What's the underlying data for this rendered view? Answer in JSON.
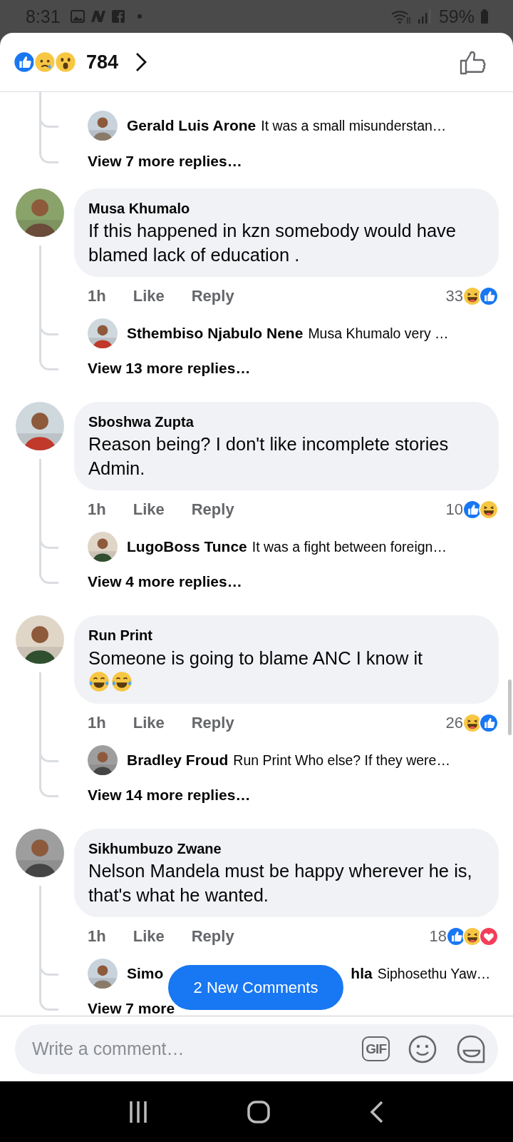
{
  "status_bar": {
    "time": "8:31",
    "battery": "59%"
  },
  "header": {
    "reactions": [
      {
        "kind": "like"
      },
      {
        "kind": "sad"
      },
      {
        "kind": "wow"
      }
    ],
    "reaction_count": "784"
  },
  "thread_top": {
    "reply": {
      "author": "Gerald Luis Arone",
      "text": "It was a small misunderstan…"
    },
    "more": "View 7 more replies…"
  },
  "comments": [
    {
      "author": "Musa Khumalo",
      "text": "If this happened in kzn somebody would have blamed lack of education .",
      "time": "1h",
      "like": "Like",
      "reply": "Reply",
      "reaction_count": "33",
      "reactions": [
        {
          "kind": "haha"
        },
        {
          "kind": "like"
        }
      ],
      "reply_preview": {
        "author": "Sthembiso Njabulo Nene",
        "text": "Musa Khumalo very …"
      },
      "more": "View 13 more replies…"
    },
    {
      "author": "Sboshwa Zupta",
      "text": "Reason being? I don't like incomplete stories Admin.",
      "time": "1h",
      "like": "Like",
      "reply": "Reply",
      "reaction_count": "10",
      "reactions": [
        {
          "kind": "like"
        },
        {
          "kind": "haha"
        }
      ],
      "reply_preview": {
        "author": "LugoBoss Tunce",
        "text": "It was a fight between foreign…"
      },
      "more": "View 4 more replies…"
    },
    {
      "author": "Run Print",
      "text": "Someone is going to blame ANC I know it",
      "emojis": [
        {
          "kind": "laugh-cry"
        },
        {
          "kind": "laugh-cry"
        }
      ],
      "time": "1h",
      "like": "Like",
      "reply": "Reply",
      "reaction_count": "26",
      "reactions": [
        {
          "kind": "haha"
        },
        {
          "kind": "like"
        }
      ],
      "reply_preview": {
        "author": "Bradley Froud",
        "text": "Run Print Who else? If they were…"
      },
      "more": "View 14 more replies…"
    },
    {
      "author": "Sikhumbuzo Zwane",
      "text": "Nelson Mandela must be happy wherever he is, that's what he wanted.",
      "time": "1h",
      "like": "Like",
      "reply": "Reply",
      "reaction_count": "18",
      "reactions": [
        {
          "kind": "like"
        },
        {
          "kind": "haha"
        },
        {
          "kind": "love"
        }
      ],
      "reply_preview": {
        "author_start": "Simo",
        "author_end": "hla",
        "text": "Siphosethu Yaw…"
      },
      "more": "View 7 more"
    }
  ],
  "new_comments_button": "2 New Comments",
  "composer": {
    "placeholder": "Write a comment…",
    "gif_label": "GIF"
  }
}
